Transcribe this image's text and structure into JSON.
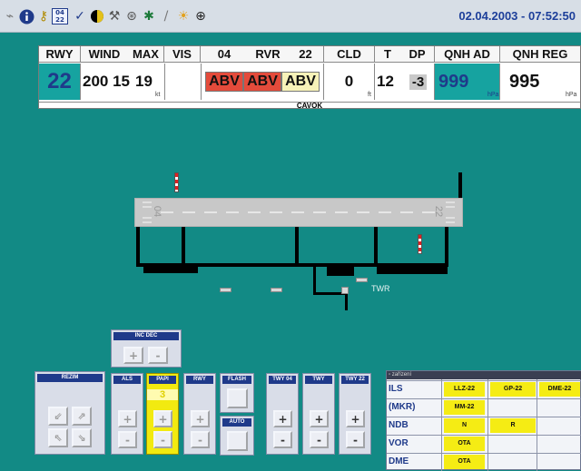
{
  "toolbar": {
    "icons": [
      "toolbar-icon-satellite",
      "info-icon",
      "key-icon",
      "rwy-select-icon",
      "check-icon",
      "day-night-icon",
      "tools-icon",
      "alarm-icon",
      "settings-icon",
      "pen-icon",
      "sun-icon",
      "globe-icon"
    ],
    "rwy_icon_top": "04",
    "rwy_icon_bottom": "22",
    "datetime": "02.04.2003 - 07:52:50"
  },
  "meteo": {
    "headers": {
      "rwy": "RWY",
      "wind": "WIND",
      "max": "MAX",
      "vis": "VIS",
      "rvr_04": "04",
      "rvr": "RVR",
      "rvr_22": "22",
      "cld": "CLD",
      "t": "T",
      "dp": "DP",
      "qnh_ad": "QNH AD",
      "qnh_reg": "QNH REG"
    },
    "rwy": "22",
    "wind": "200 15",
    "max": "19",
    "max_unit": "kt",
    "vis": "",
    "rvr_values": [
      "ABV",
      "ABV",
      "ABV"
    ],
    "rvr_colors": [
      "#e44b3b",
      "#e44b3b",
      "#f7f2b8"
    ],
    "cld": "0",
    "cld_unit": "ft",
    "t": "12",
    "dp": "-3",
    "qnh_ad": "999",
    "qnh_ad_unit": "hPa",
    "qnh_reg": "995",
    "qnh_reg_unit": "hPa",
    "cavok": "CAVOK"
  },
  "airport": {
    "rwy_left_number": "04",
    "rwy_right_number": "22",
    "twr_label": "TWR"
  },
  "panels": {
    "incdec_title": "INC DEC",
    "rezim_title": "REZIM",
    "als_title": "ALS",
    "papi_title": "PAPI",
    "papi_value": "3",
    "rwy_title": "RWY",
    "flash_title": "FLASH",
    "auto_title": "AUTO",
    "twy04_title": "TWY 04",
    "twy_title": "TWY",
    "twy22_title": "TWY 22",
    "plus": "+",
    "minus": "-"
  },
  "navaid": {
    "window_title": "zařízení",
    "rows": [
      {
        "label": "ILS",
        "cells": [
          "LLZ-22",
          "GP-22",
          "DME-22"
        ]
      },
      {
        "label": "(MKR)",
        "cells": [
          "MM-22",
          "",
          ""
        ]
      },
      {
        "label": "NDB",
        "cells": [
          "N",
          "R",
          ""
        ]
      },
      {
        "label": "VOR",
        "cells": [
          "OTA",
          "",
          ""
        ]
      },
      {
        "label": "DME",
        "cells": [
          "OTA",
          "",
          ""
        ]
      }
    ],
    "colors": {
      "active": "#f5ec14"
    }
  }
}
